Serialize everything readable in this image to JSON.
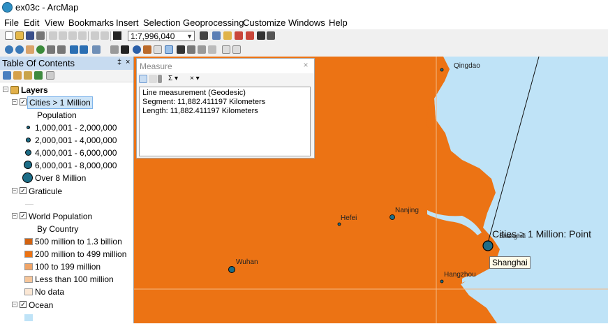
{
  "window": {
    "title": "ex03c - ArcMap"
  },
  "menu": [
    "File",
    "Edit",
    "View",
    "Bookmarks",
    "Insert",
    "Selection",
    "Geoprocessing",
    "Customize",
    "Windows",
    "Help"
  ],
  "toolbar": {
    "scale": "1:7,996,040"
  },
  "toc": {
    "title": "Table Of Contents",
    "pin_glyph": "‡",
    "close_glyph": "×",
    "layers_label": "Layers",
    "cities_layer": "Cities > 1 Million",
    "cities_field": "Population",
    "cities_classes": [
      "1,000,001 - 2,000,000",
      "2,000,001 - 4,000,000",
      "4,000,001 - 6,000,000",
      "6,000,001 - 8,000,000",
      "Over 8 Million"
    ],
    "graticule_layer": "Graticule",
    "worldpop_layer": "World Population",
    "worldpop_field": "By Country",
    "worldpop_classes": [
      {
        "label": "500 million to 1.3 billion",
        "color": "#d3620f"
      },
      {
        "label": "200 million to 499 million",
        "color": "#ec7314"
      },
      {
        "label": "100 to 199 million",
        "color": "#f0a467"
      },
      {
        "label": "Less than 100 million",
        "color": "#f6c69a"
      },
      {
        "label": "No data",
        "color": "#fbe7d4"
      }
    ],
    "ocean_layer": "Ocean",
    "ocean_color": "#bfe3f7"
  },
  "measure": {
    "title": "Measure",
    "close": "×",
    "tools": {
      "sigma": "Σ ▾",
      "clear": "× ▾"
    },
    "result_type": "Line measurement (Geodesic)",
    "segment": "Segment: 11,882.411197 Kilometers",
    "length": "Length: 11,882.411197 Kilometers"
  },
  "map": {
    "land_color": "#ec7314",
    "ocean_color": "#bfe3f7",
    "cities": {
      "qingdao": "Qingdao",
      "hefei": "Hefei",
      "nanjing": "Nanjing",
      "shanghai": "Shanghai",
      "wuhan": "Wuhan",
      "hangzhou": "Hangzhou"
    },
    "tooltip": "Shanghai",
    "hover_label": "Cities > 1 Million: Point"
  }
}
